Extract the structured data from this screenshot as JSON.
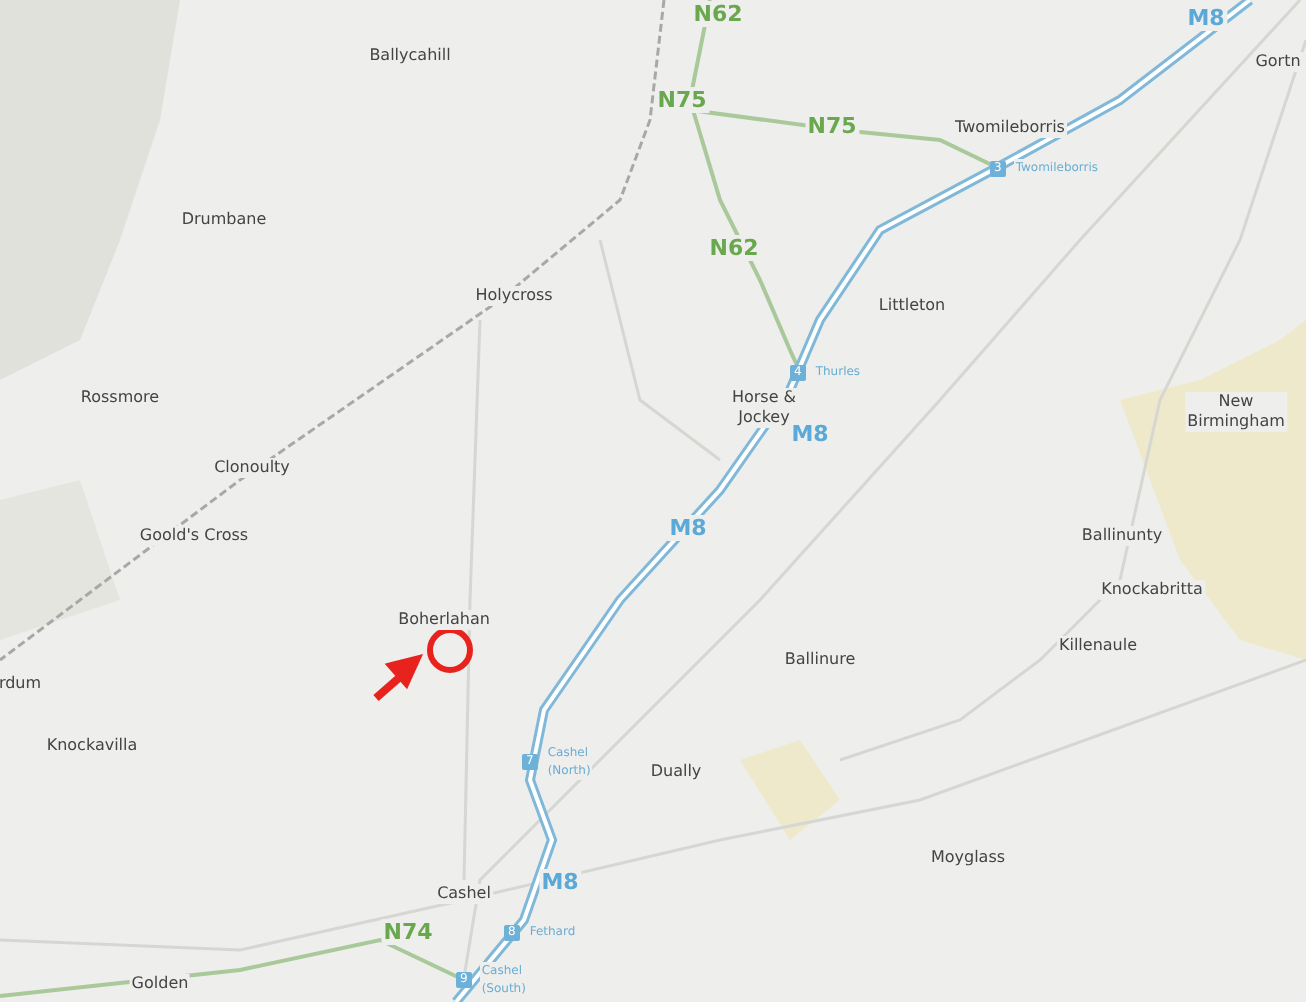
{
  "map": {
    "places": [
      {
        "name": "Ballycahill"
      },
      {
        "name": "Drumbane"
      },
      {
        "name": "Holycross"
      },
      {
        "name": "Rossmore"
      },
      {
        "name": "Clonoulty"
      },
      {
        "name": "Goold's Cross"
      },
      {
        "name": "Boherlahan"
      },
      {
        "name": "rdum"
      },
      {
        "name": "Knockavilla"
      },
      {
        "name": "Cashel"
      },
      {
        "name": "Golden"
      },
      {
        "name": "Twomileborris"
      },
      {
        "name": "Littleton"
      },
      {
        "name": "Horse & Jockey"
      },
      {
        "name": "New Birmingham"
      },
      {
        "name": "Ballinunty"
      },
      {
        "name": "Knockabritta"
      },
      {
        "name": "Killenaule"
      },
      {
        "name": "Ballinure"
      },
      {
        "name": "Dually"
      },
      {
        "name": "Moyglass"
      },
      {
        "name": "Gortn"
      }
    ],
    "roads": [
      {
        "label": "N62",
        "kind": "national"
      },
      {
        "label": "N75",
        "kind": "national"
      },
      {
        "label": "N75",
        "kind": "national"
      },
      {
        "label": "N62",
        "kind": "national"
      },
      {
        "label": "M8",
        "kind": "motorway"
      },
      {
        "label": "M8",
        "kind": "motorway"
      },
      {
        "label": "M8",
        "kind": "motorway"
      },
      {
        "label": "M8",
        "kind": "motorway"
      },
      {
        "label": "N74",
        "kind": "national"
      }
    ],
    "junctions": [
      {
        "number": "3",
        "label": "Twomileborris"
      },
      {
        "number": "4",
        "label": "Thurles"
      },
      {
        "number": "7",
        "label": "Cashel (North)"
      },
      {
        "number": "8",
        "label": "Fethard"
      },
      {
        "number": "9",
        "label": "Cashel (South)"
      }
    ]
  }
}
